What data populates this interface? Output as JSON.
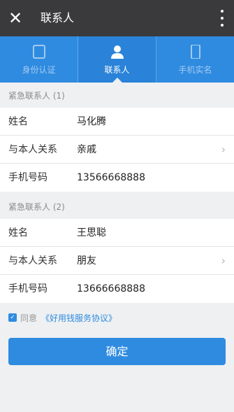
{
  "titlebar": {
    "title": "联系人",
    "close_icon": "close-icon",
    "more_icon": "more-vertical-icon"
  },
  "tabs": [
    {
      "label": "身份认证",
      "icon": "id-card-icon",
      "active": false
    },
    {
      "label": "联系人",
      "icon": "person-icon",
      "active": true
    },
    {
      "label": "手机实名",
      "icon": "phone-icon",
      "active": false
    }
  ],
  "contacts": [
    {
      "title": "紧急联系人 (1)",
      "fields": [
        {
          "label": "姓名",
          "value": "马化腾"
        },
        {
          "label": "与本人关系",
          "value": "亲戚"
        },
        {
          "label": "手机号码",
          "value": "13566668888"
        }
      ]
    },
    {
      "title": "紧急联系人 (2)",
      "fields": [
        {
          "label": "姓名",
          "value": "王思聪"
        },
        {
          "label": "与本人关系",
          "value": "朋友"
        },
        {
          "label": "手机号码",
          "value": "13666668888"
        }
      ]
    }
  ],
  "agreement": {
    "checked": true,
    "prefix": "同意",
    "link": "《好用钱服务协议》"
  },
  "confirm_label": "确定",
  "colors": {
    "accent": "#2f8be0",
    "titlebar": "#3a3a3c",
    "background": "#eef0f2"
  }
}
